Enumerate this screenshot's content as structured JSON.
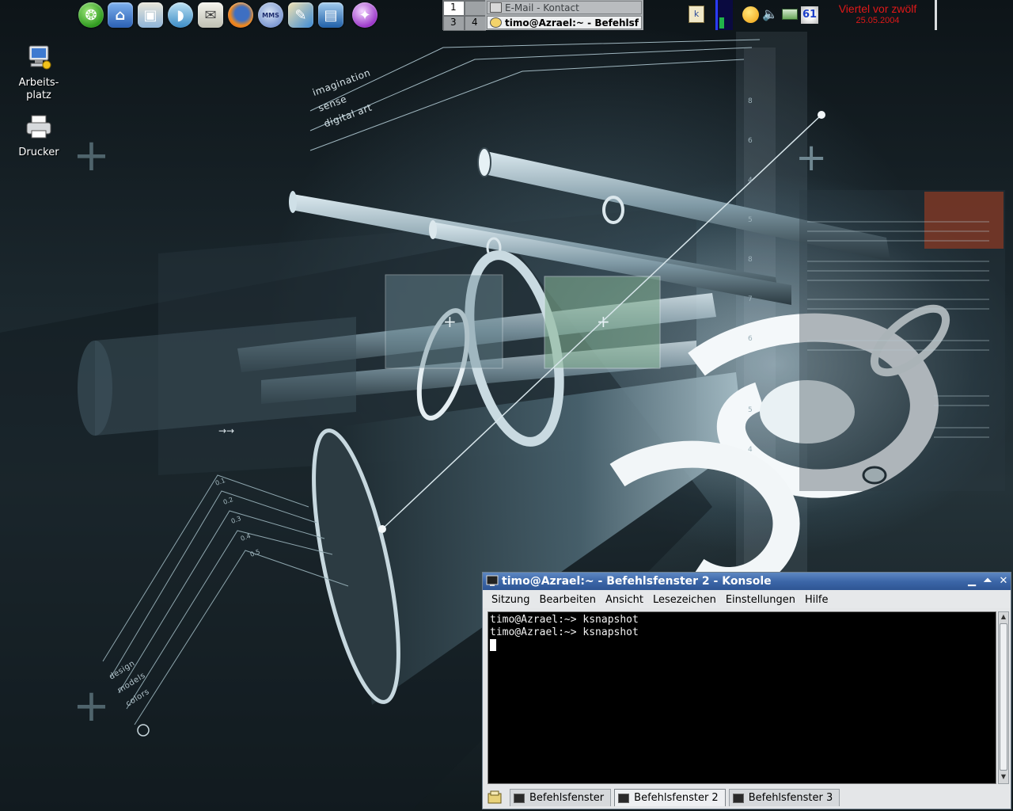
{
  "panel": {
    "launchers": [
      {
        "icon": "kde-menu-icon",
        "label": ""
      },
      {
        "icon": "home-folder-icon",
        "label": ""
      },
      {
        "icon": "image-viewer-icon",
        "label": ""
      },
      {
        "icon": "dolphin-icon",
        "label": ""
      },
      {
        "icon": "email-client-icon",
        "label": ""
      },
      {
        "icon": "firefox-icon",
        "label": ""
      },
      {
        "icon": "messenger-icon",
        "label": "MMS"
      },
      {
        "icon": "paint-icon",
        "label": ""
      },
      {
        "icon": "picture-editor-icon",
        "label": ""
      },
      {
        "icon": "tips-icon",
        "label": ""
      }
    ],
    "pager": {
      "desktops": [
        "1",
        "",
        "3",
        "4"
      ],
      "active": "1"
    },
    "tasks": [
      {
        "label": "E-Mail - Kontact",
        "active": false
      },
      {
        "label": "timo@Azrael:~ - Befehlsf",
        "active": true
      }
    ],
    "tray": {
      "badge_number": "61"
    },
    "clock": {
      "time": "Viertel vor zwölf",
      "date": "25.05.2004"
    },
    "colors": {
      "clock": "#e01818",
      "titlebar": "#3c67a8"
    }
  },
  "desktop": {
    "icons": [
      {
        "label_line1": "Arbeits-",
        "label_line2": "platz",
        "icon": "computer-icon"
      },
      {
        "label_line1": "Drucker",
        "label_line2": "",
        "icon": "printer-icon"
      }
    ]
  },
  "wallpaper": {
    "text_lines": [
      "imagination",
      "sense",
      "digital art"
    ],
    "lower_text": [
      "design",
      "models",
      "colors"
    ],
    "scale_labels": [
      "0.1",
      "0.2",
      "0.3",
      "0.4",
      "0.5"
    ]
  },
  "konsole": {
    "title": "timo@Azrael:~ - Befehlsfenster 2 - Konsole",
    "menu": [
      "Sitzung",
      "Bearbeiten",
      "Ansicht",
      "Lesezeichen",
      "Einstellungen",
      "Hilfe"
    ],
    "lines": [
      "timo@Azrael:~> ksnapshot",
      "timo@Azrael:~> ksnapshot"
    ],
    "tabs": [
      {
        "label": "Befehlsfenster",
        "active": false
      },
      {
        "label": "Befehlsfenster 2",
        "active": true
      },
      {
        "label": "Befehlsfenster 3",
        "active": false
      }
    ]
  }
}
